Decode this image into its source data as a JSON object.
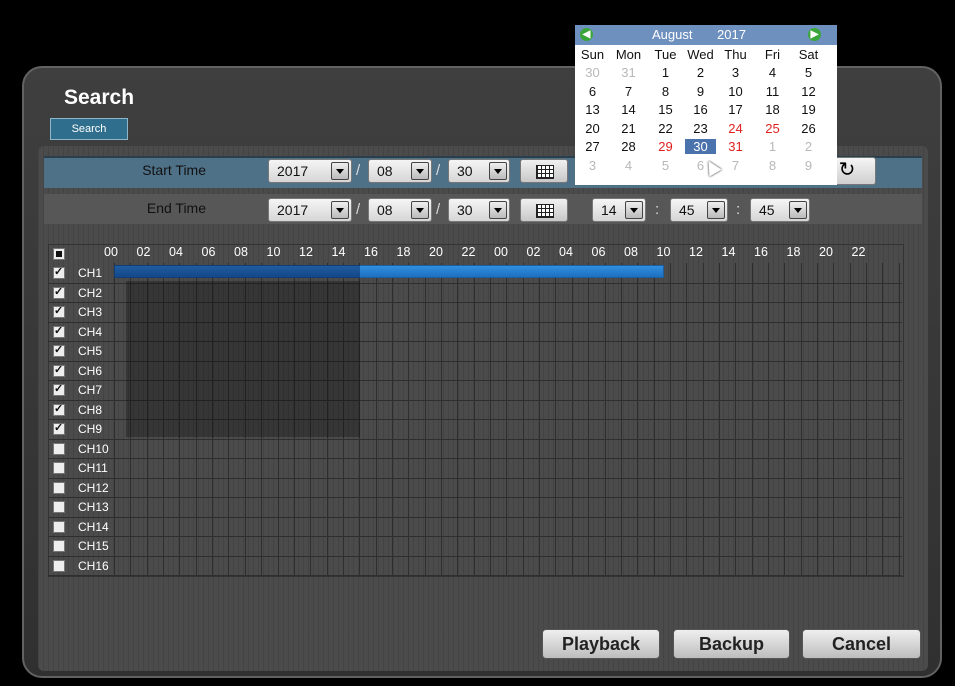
{
  "title": "Search",
  "tab_label": "Search",
  "start_time": {
    "label": "Start Time",
    "year": "2017",
    "month": "08",
    "day": "30"
  },
  "end_time": {
    "label": "End Time",
    "year": "2017",
    "month": "08",
    "day": "30",
    "hour": "14",
    "minute": "45",
    "second": "45"
  },
  "separators": {
    "date": "/",
    "time": ":"
  },
  "grid": {
    "hours": [
      "00",
      "02",
      "04",
      "06",
      "08",
      "10",
      "12",
      "14",
      "16",
      "18",
      "20",
      "22",
      "00",
      "02",
      "04",
      "06",
      "08",
      "10",
      "12",
      "14",
      "16",
      "18",
      "20",
      "22"
    ],
    "channels": [
      {
        "label": "CH1",
        "checked": true
      },
      {
        "label": "CH2",
        "checked": true
      },
      {
        "label": "CH3",
        "checked": true
      },
      {
        "label": "CH4",
        "checked": true
      },
      {
        "label": "CH5",
        "checked": true
      },
      {
        "label": "CH6",
        "checked": true
      },
      {
        "label": "CH7",
        "checked": true
      },
      {
        "label": "CH8",
        "checked": true
      },
      {
        "label": "CH9",
        "checked": true
      },
      {
        "label": "CH10",
        "checked": false
      },
      {
        "label": "CH11",
        "checked": false
      },
      {
        "label": "CH12",
        "checked": false
      },
      {
        "label": "CH13",
        "checked": false
      },
      {
        "label": "CH14",
        "checked": false
      },
      {
        "label": "CH15",
        "checked": false
      },
      {
        "label": "CH16",
        "checked": false
      }
    ]
  },
  "buttons": {
    "playback": "Playback",
    "backup": "Backup",
    "cancel": "Cancel",
    "refresh_icon": "refresh-icon"
  },
  "calendar": {
    "month": "August",
    "year": "2017",
    "weekdays": [
      "Sun",
      "Mon",
      "Tue",
      "Wed",
      "Thu",
      "Fri",
      "Sat"
    ],
    "weeks": [
      [
        {
          "d": "30",
          "other": true
        },
        {
          "d": "31",
          "other": true
        },
        {
          "d": "1"
        },
        {
          "d": "2"
        },
        {
          "d": "3"
        },
        {
          "d": "4"
        },
        {
          "d": "5"
        }
      ],
      [
        {
          "d": "6"
        },
        {
          "d": "7"
        },
        {
          "d": "8"
        },
        {
          "d": "9"
        },
        {
          "d": "10"
        },
        {
          "d": "11"
        },
        {
          "d": "12"
        }
      ],
      [
        {
          "d": "13"
        },
        {
          "d": "14"
        },
        {
          "d": "15"
        },
        {
          "d": "16"
        },
        {
          "d": "17"
        },
        {
          "d": "18"
        },
        {
          "d": "19"
        }
      ],
      [
        {
          "d": "20"
        },
        {
          "d": "21"
        },
        {
          "d": "22"
        },
        {
          "d": "23"
        },
        {
          "d": "24",
          "red": true
        },
        {
          "d": "25",
          "red": true
        },
        {
          "d": "26"
        }
      ],
      [
        {
          "d": "27"
        },
        {
          "d": "28"
        },
        {
          "d": "29",
          "red": true
        },
        {
          "d": "30",
          "selected": true
        },
        {
          "d": "31",
          "red": true
        },
        {
          "d": "1",
          "other": true
        },
        {
          "d": "2",
          "other": true
        }
      ],
      [
        {
          "d": "3",
          "other": true
        },
        {
          "d": "4",
          "other": true
        },
        {
          "d": "5",
          "other": true
        },
        {
          "d": "6",
          "other": true
        },
        {
          "d": "7",
          "other": true
        },
        {
          "d": "8",
          "other": true
        },
        {
          "d": "9",
          "other": true
        }
      ]
    ]
  },
  "colors": {
    "accent": "#2f6e8c",
    "bar": "#2f8fe0",
    "holiday": "#e02020",
    "selected": "#4a73ad"
  }
}
